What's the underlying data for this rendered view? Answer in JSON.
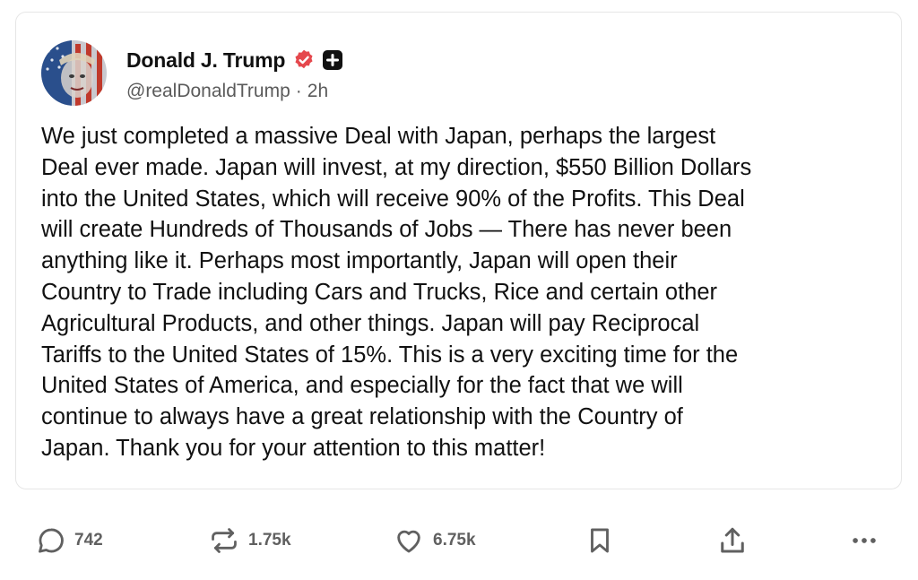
{
  "post": {
    "author": {
      "display_name": "Donald J. Trump",
      "handle": "@realDonaldTrump",
      "separator": "·",
      "time": "2h",
      "verified_icon": "verified-badge-icon",
      "plus_icon": "plus-badge-icon"
    },
    "text": "We just completed a massive Deal with Japan, perhaps the largest\nDeal ever made. Japan will invest, at my direction, $550 Billion Dollars\ninto the United States, which will receive 90% of the Profits. This Deal\nwill create Hundreds of Thousands of Jobs — There has never been\nanything like it. Perhaps most importantly, Japan will open their\nCountry to Trade including Cars and Trucks, Rice and certain other\nAgricultural Products, and other things. Japan will pay Reciprocal\nTariffs to the United States of 15%. This is a very exciting time for the\nUnited States of America, and especially for the fact that we will\ncontinue to always have a great relationship with the Country of\nJapan. Thank you for your attention to this matter!"
  },
  "actions": {
    "reply": {
      "icon": "reply-icon",
      "count": "742"
    },
    "retruth": {
      "icon": "retruth-icon",
      "count": "1.75k"
    },
    "like": {
      "icon": "heart-icon",
      "count": "6.75k"
    },
    "bookmark": {
      "icon": "bookmark-icon"
    },
    "share": {
      "icon": "share-icon"
    },
    "more": {
      "icon": "more-icon"
    }
  },
  "colors": {
    "text": "#111111",
    "muted": "#5b5b5b",
    "icon": "#606060",
    "verified": "#e5484d",
    "border": "#e6e6e6"
  }
}
